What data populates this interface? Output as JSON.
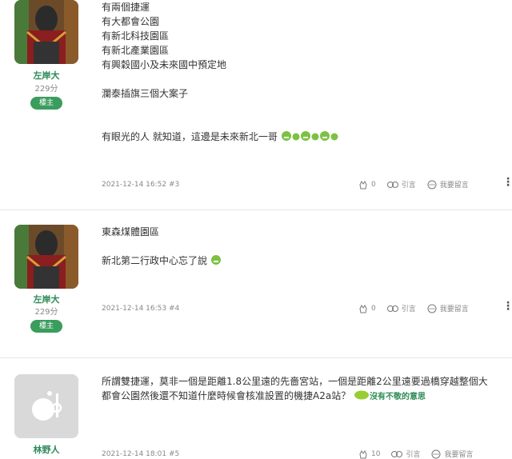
{
  "posts": [
    {
      "user": {
        "name": "左岸大",
        "points": "229分",
        "badge": "樓主"
      },
      "lines": [
        "有兩個捷運",
        "有大都會公園",
        "有新北科技園區",
        "有新北產業園區",
        "有興穀國小及未來國中預定地",
        "",
        "瀾泰插旗三個大案子",
        "",
        "",
        "有眼光的人 就知道，這邊是未來新北一哥"
      ],
      "meta": "2021-12-14 16:52 #3",
      "likes": "0",
      "quote": "引言",
      "reply": "我要留言"
    },
    {
      "user": {
        "name": "左岸大",
        "points": "229分",
        "badge": "樓主"
      },
      "lines": [
        "東森煤體園區",
        "",
        "新北第二行政中心忘了說"
      ],
      "meta": "2021-12-14 16:53 #4",
      "likes": "0",
      "quote": "引言",
      "reply": "我要留言"
    },
    {
      "user": {
        "name": "林野人"
      },
      "lines": [
        "所謂雙捷運，莫非一個是距離1.8公里遠的先嗇宮站，一個是距離2公里遠要過橋穿越整個大",
        "都會公園然後還不知道什麼時候會核准設置的機捷A2a站？"
      ],
      "annotation": "沒有不敬的意思",
      "meta": "2021-12-14 18:01 #5",
      "likes": "10",
      "quote": "引言",
      "reply": "我要留言"
    }
  ],
  "icons": [
    "clap-icon",
    "quote-icon",
    "comment-icon",
    "more-icon",
    "grin-emoji-icon",
    "default-avatar-icon"
  ]
}
